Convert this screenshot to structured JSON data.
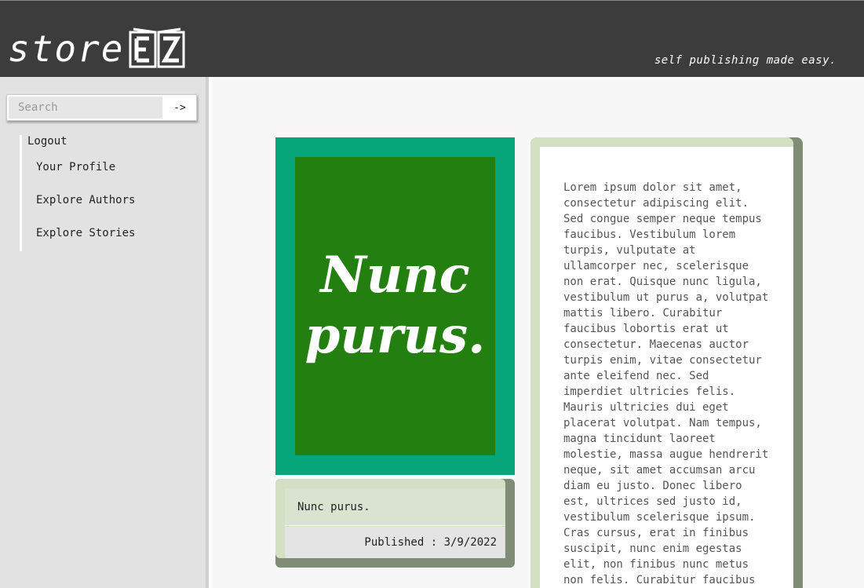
{
  "header": {
    "logo_text": "store",
    "logo_icon": "book-ez-icon",
    "tagline": "self publishing made easy."
  },
  "sidebar": {
    "search": {
      "placeholder": "Search",
      "button_label": "->"
    },
    "nav": {
      "logout_label": "Logout",
      "items": [
        {
          "label": "Your Profile"
        },
        {
          "label": "Explore Authors"
        },
        {
          "label": "Explore Stories"
        }
      ]
    }
  },
  "book": {
    "cover_title": "Nunc purus.",
    "title": "Nunc purus.",
    "published": "Published : 3/9/2022",
    "description": "Lorem ipsum dolor sit amet,\nconsectetur adipiscing elit.\nSed congue semper neque tempus\nfaucibus. Vestibulum lorem\nturpis, vulputate at\nullamcorper nec, scelerisque\nnon erat. Quisque nunc ligula,\nvestibulum ut purus a, volutpat\nmattis libero. Curabitur\nfaucibus lobortis erat ut\nconsectetur. Maecenas auctor\nturpis enim, vitae consectetur\nante eleifend nec. Sed\nimperdiet ultricies felis.\nMauris ultricies dui eget\nplacerat volutpat. Nam tempus,\nmagna tincidunt laoreet\nmolestie, massa augue hendrerit\nneque, sit amet accumsan arcu\ndiam eu justo. Donec libero\nest, ultrices sed justo id,\nvestibulum scelerisque ipsum.\nCras cursus, erat in finibus\nsuscipit, nunc enim egestas\nelit, non finibus nunc metus\nnon felis. Curabitur faucibus\nlibero mi, et ullamcorper eros"
  },
  "colors": {
    "header_bg": "#3c3c3c",
    "cover_outer": "#07a57a",
    "cover_inner": "#238010",
    "card_light": "#d4e0c4",
    "card_shadow": "#808d76"
  }
}
